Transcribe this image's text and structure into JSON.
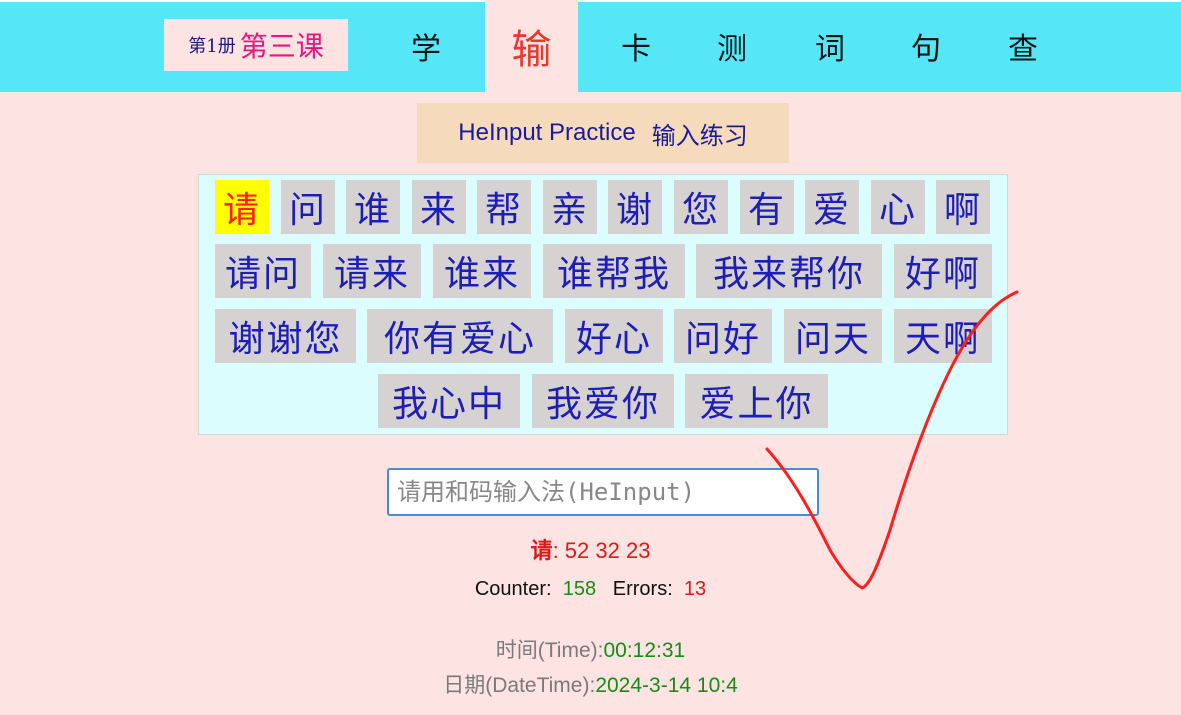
{
  "lesson": {
    "book": "第1册",
    "lesson": "第三课"
  },
  "nav": {
    "tabs": [
      {
        "label": "学"
      },
      {
        "label": "输"
      },
      {
        "label": "卡"
      },
      {
        "label": "测"
      },
      {
        "label": "词"
      },
      {
        "label": "句"
      },
      {
        "label": "查"
      }
    ],
    "active_index": 1
  },
  "title": {
    "en": "HeInput Practice",
    "cn": "输入练习"
  },
  "practice": {
    "rows": [
      [
        "请",
        "问",
        "谁",
        "来",
        "帮",
        "亲",
        "谢",
        "您",
        "有",
        "爱",
        "心",
        "啊"
      ],
      [
        "请问",
        "请来",
        "谁来",
        "谁帮我",
        "我来帮你",
        "好啊"
      ],
      [
        "谢谢您",
        "你有爱心",
        "好心",
        "问好",
        "问天",
        "天啊"
      ],
      [
        "我心中",
        "我爱你",
        "爱上你"
      ]
    ],
    "current": "请"
  },
  "input": {
    "placeholder": "请用和码输入法(HeInput)",
    "value": ""
  },
  "code_hint": {
    "char": "请",
    "codes": ": 52 32 23"
  },
  "stats": {
    "counter_label": "Counter:",
    "counter": "158",
    "errors_label": "Errors:",
    "errors": "13"
  },
  "time": {
    "label": "时间(Time):",
    "value": "00:12:31"
  },
  "date": {
    "label": "日期(DateTime):",
    "value": "2024-3-14 10:4"
  },
  "colors": {
    "topbar": "#55e7f8",
    "background": "#fde3e1",
    "tile_text": "#1d1db8",
    "current_tile": "#ffff00",
    "checkmark": "#ff1f1f"
  }
}
